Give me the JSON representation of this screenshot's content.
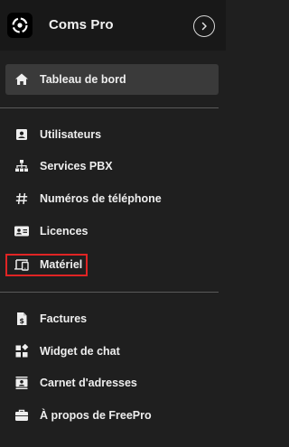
{
  "app": {
    "title": "Coms Pro"
  },
  "nav": {
    "dashboard": "Tableau de bord",
    "group1": [
      "Utilisateurs",
      "Services PBX",
      "Numéros de téléphone",
      "Licences",
      "Matériel"
    ],
    "group2": [
      "Factures",
      "Widget de chat",
      "Carnet d'adresses",
      "À propos de FreePro"
    ]
  },
  "colors": {
    "background": "#1f1f1f",
    "header": "#181818",
    "active_item": "#3a3a3a",
    "highlight": "#e02424",
    "text": "#eeeeee"
  }
}
